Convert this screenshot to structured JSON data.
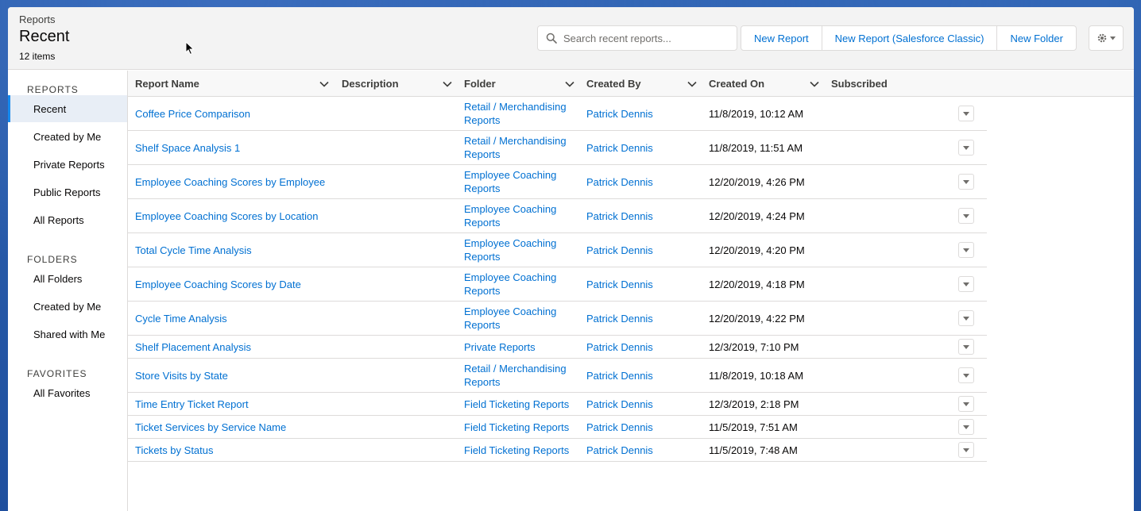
{
  "header": {
    "breadcrumb": "Reports",
    "title": "Recent",
    "count": "12 items",
    "search_placeholder": "Search recent reports...",
    "buttons": [
      "New Report",
      "New Report (Salesforce Classic)",
      "New Folder"
    ]
  },
  "sidebar": {
    "sections": [
      {
        "heading": "REPORTS",
        "items": [
          "Recent",
          "Created by Me",
          "Private Reports",
          "Public Reports",
          "All Reports"
        ]
      },
      {
        "heading": "FOLDERS",
        "items": [
          "All Folders",
          "Created by Me",
          "Shared with Me"
        ]
      },
      {
        "heading": "FAVORITES",
        "items": [
          "All Favorites"
        ]
      }
    ],
    "active_item": "Recent"
  },
  "table": {
    "columns": [
      "Report Name",
      "Description",
      "Folder",
      "Created By",
      "Created On",
      "Subscribed"
    ],
    "rows": [
      {
        "name": "Coffee Price Comparison",
        "folder_l1": "Retail / Merchandising",
        "folder_l2": "Reports",
        "created_by": "Patrick Dennis",
        "created_on": "11/8/2019, 10:12 AM"
      },
      {
        "name": "Shelf Space Analysis 1",
        "folder_l1": "Retail / Merchandising",
        "folder_l2": "Reports",
        "created_by": "Patrick Dennis",
        "created_on": "11/8/2019, 11:51 AM"
      },
      {
        "name": "Employee Coaching Scores by Employee",
        "folder_l1": "Employee Coaching",
        "folder_l2": "Reports",
        "created_by": "Patrick Dennis",
        "created_on": "12/20/2019, 4:26 PM"
      },
      {
        "name": "Employee Coaching Scores by Location",
        "folder_l1": "Employee Coaching",
        "folder_l2": "Reports",
        "created_by": "Patrick Dennis",
        "created_on": "12/20/2019, 4:24 PM"
      },
      {
        "name": "Total Cycle Time Analysis",
        "folder_l1": "Employee Coaching",
        "folder_l2": "Reports",
        "created_by": "Patrick Dennis",
        "created_on": "12/20/2019, 4:20 PM"
      },
      {
        "name": "Employee Coaching Scores by Date",
        "folder_l1": "Employee Coaching",
        "folder_l2": "Reports",
        "created_by": "Patrick Dennis",
        "created_on": "12/20/2019, 4:18 PM"
      },
      {
        "name": "Cycle Time Analysis",
        "folder_l1": "Employee Coaching",
        "folder_l2": "Reports",
        "created_by": "Patrick Dennis",
        "created_on": "12/20/2019, 4:22 PM"
      },
      {
        "name": "Shelf Placement Analysis",
        "folder_l1": "Private Reports",
        "folder_l2": "",
        "created_by": "Patrick Dennis",
        "created_on": "12/3/2019, 7:10 PM"
      },
      {
        "name": "Store Visits by State",
        "folder_l1": "Retail / Merchandising",
        "folder_l2": "Reports",
        "created_by": "Patrick Dennis",
        "created_on": "11/8/2019, 10:18 AM"
      },
      {
        "name": "Time Entry Ticket Report",
        "folder_l1": "Field Ticketing Reports",
        "folder_l2": "",
        "created_by": "Patrick Dennis",
        "created_on": "12/3/2019, 2:18 PM"
      },
      {
        "name": "Ticket Services by Service Name",
        "folder_l1": "Field Ticketing Reports",
        "folder_l2": "",
        "created_by": "Patrick Dennis",
        "created_on": "11/5/2019, 7:51 AM"
      },
      {
        "name": "Tickets by Status",
        "folder_l1": "Field Ticketing Reports",
        "folder_l2": "",
        "created_by": "Patrick Dennis",
        "created_on": "11/5/2019, 7:48 AM"
      }
    ]
  },
  "colors": {
    "link": "#0070d2",
    "active_bar": "#1589ee",
    "border": "#dddbda"
  }
}
